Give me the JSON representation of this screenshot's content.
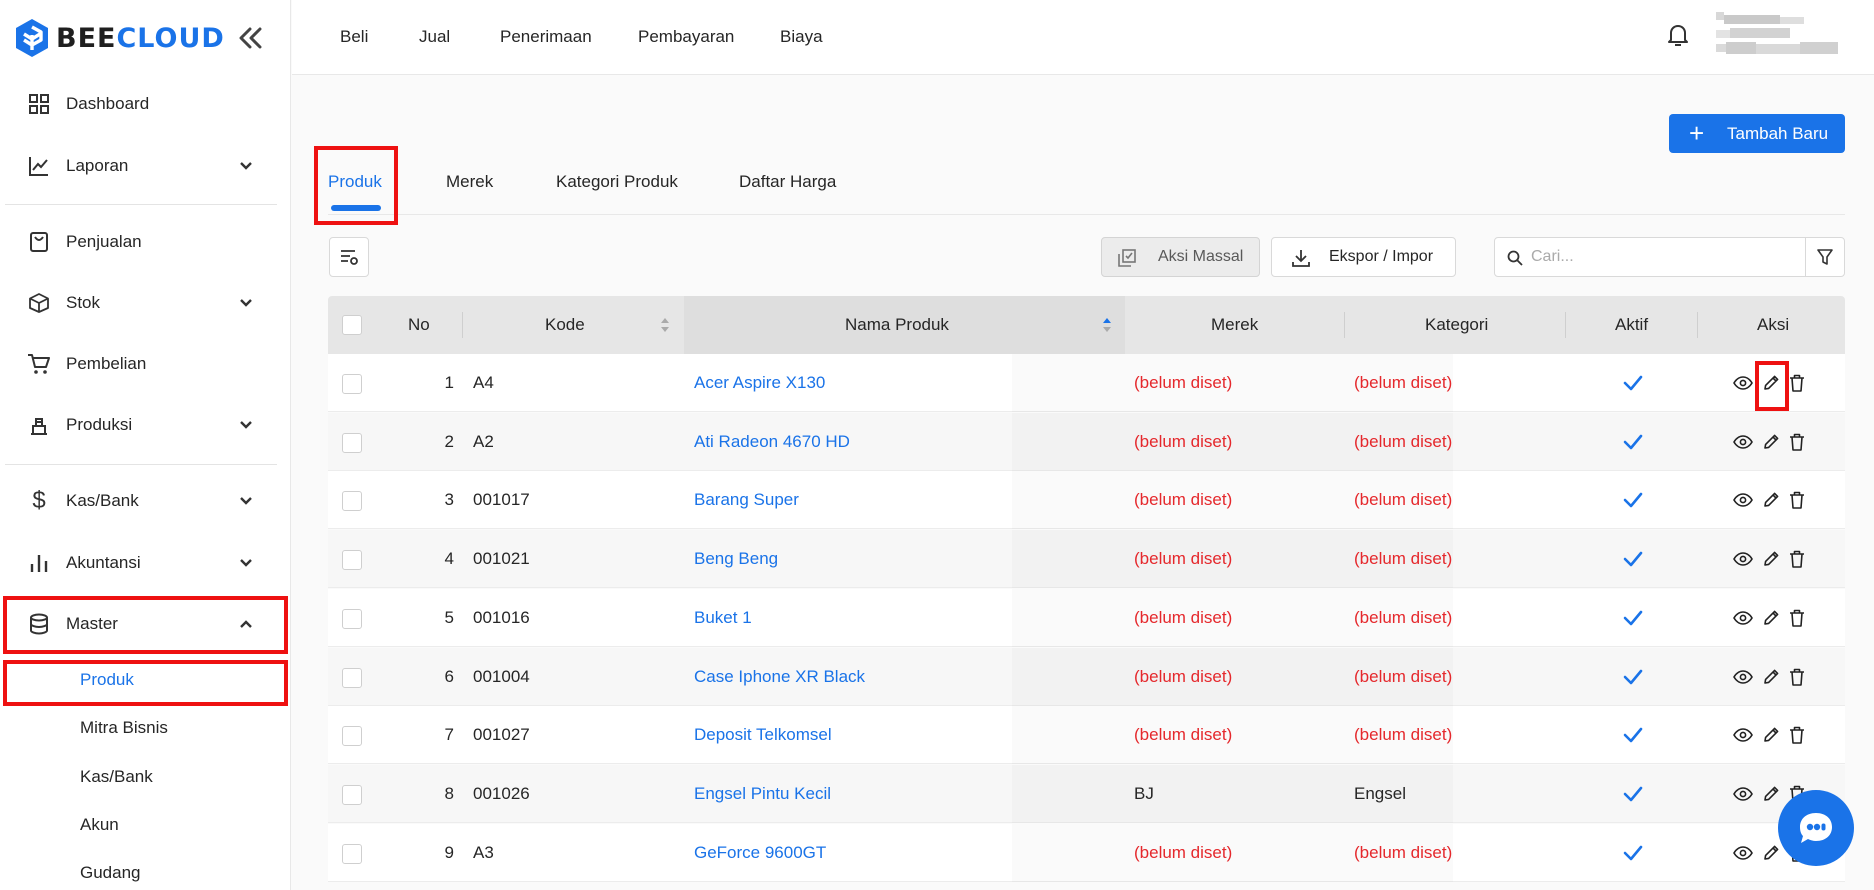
{
  "brand": {
    "name_a": "BEE",
    "name_b": "CLOUD"
  },
  "sidebar": {
    "items": [
      {
        "label": "Dashboard",
        "icon": "grid-icon"
      },
      {
        "label": "Laporan",
        "icon": "line-chart-icon"
      },
      {
        "label": "Penjualan",
        "icon": "bag-icon"
      },
      {
        "label": "Stok",
        "icon": "box-icon"
      },
      {
        "label": "Pembelian",
        "icon": "cart-icon"
      },
      {
        "label": "Produksi",
        "icon": "factory-icon"
      },
      {
        "label": "Kas/Bank",
        "icon": "dollar-icon"
      },
      {
        "label": "Akuntansi",
        "icon": "bar-chart-icon"
      },
      {
        "label": "Master",
        "icon": "database-icon"
      }
    ],
    "sub_items": [
      {
        "label": "Produk"
      },
      {
        "label": "Mitra Bisnis"
      },
      {
        "label": "Kas/Bank"
      },
      {
        "label": "Akun"
      },
      {
        "label": "Gudang"
      }
    ]
  },
  "topnav": [
    "Beli",
    "Jual",
    "Penerimaan",
    "Pembayaran",
    "Biaya"
  ],
  "actions": {
    "add_label": "Tambah Baru",
    "bulk_label": "Aksi Massal",
    "export_label": "Ekspor / Impor",
    "search_placeholder": "Cari..."
  },
  "tabs": [
    "Produk",
    "Merek",
    "Kategori Produk",
    "Daftar Harga"
  ],
  "table": {
    "headers": [
      "No",
      "Kode",
      "Nama Produk",
      "Merek",
      "Kategori",
      "Aktif",
      "Aksi"
    ],
    "rows": [
      {
        "no": "1",
        "kode": "A4",
        "nama": "Acer Aspire X130",
        "merek": "(belum diset)",
        "kategori": "(belum diset)"
      },
      {
        "no": "2",
        "kode": "A2",
        "nama": "Ati Radeon 4670 HD",
        "merek": "(belum diset)",
        "kategori": "(belum diset)"
      },
      {
        "no": "3",
        "kode": "001017",
        "nama": "Barang Super",
        "merek": "(belum diset)",
        "kategori": "(belum diset)"
      },
      {
        "no": "4",
        "kode": "001021",
        "nama": "Beng Beng",
        "merek": "(belum diset)",
        "kategori": "(belum diset)"
      },
      {
        "no": "5",
        "kode": "001016",
        "nama": "Buket 1",
        "merek": "(belum diset)",
        "kategori": "(belum diset)"
      },
      {
        "no": "6",
        "kode": "001004",
        "nama": "Case Iphone XR Black",
        "merek": "(belum diset)",
        "kategori": "(belum diset)"
      },
      {
        "no": "7",
        "kode": "001027",
        "nama": "Deposit Telkomsel",
        "merek": "(belum diset)",
        "kategori": "(belum diset)"
      },
      {
        "no": "8",
        "kode": "001026",
        "nama": "Engsel Pintu Kecil",
        "merek": "BJ",
        "kategori": "Engsel"
      },
      {
        "no": "9",
        "kode": "A3",
        "nama": "GeForce 9600GT",
        "merek": "(belum diset)",
        "kategori": "(belum diset)"
      }
    ]
  },
  "colors": {
    "accent": "#1a73e8",
    "unset": "#e5282c",
    "highlight": "#ee1111"
  }
}
